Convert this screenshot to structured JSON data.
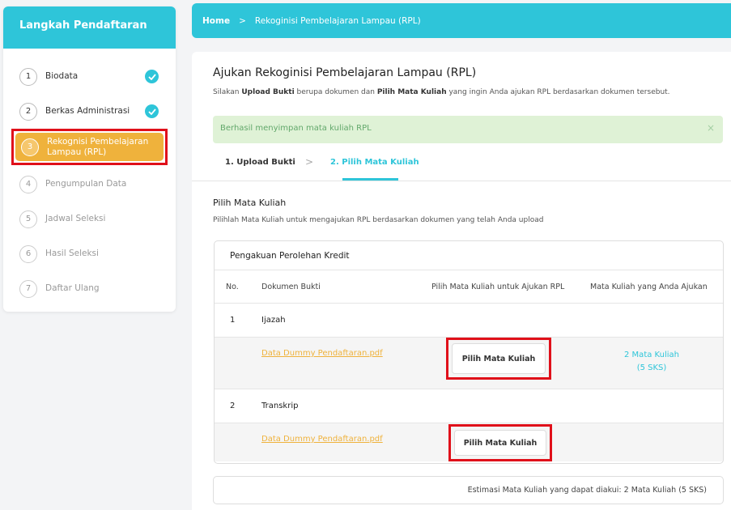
{
  "sidebar": {
    "title": "Langkah Pendaftaran",
    "steps": [
      {
        "num": "1",
        "label": "Biodata"
      },
      {
        "num": "2",
        "label": "Berkas Administrasi"
      },
      {
        "num": "3",
        "label": "Rekognisi Pembelajaran Lampau (RPL)"
      },
      {
        "num": "4",
        "label": "Pengumpulan Data"
      },
      {
        "num": "5",
        "label": "Jadwal Seleksi"
      },
      {
        "num": "6",
        "label": "Hasil Seleksi"
      },
      {
        "num": "7",
        "label": "Daftar Ulang"
      }
    ]
  },
  "breadcrumb": {
    "home": "Home",
    "separator": ">",
    "current": "Rekoginisi Pembelajaran Lampau (RPL)"
  },
  "page": {
    "title": "Ajukan Rekoginisi Pembelajaran Lampau (RPL)",
    "desc_prefix": "Silakan ",
    "desc_b1": "Upload Bukti",
    "desc_mid": " berupa dokumen dan ",
    "desc_b2": "Pilih Mata Kuliah",
    "desc_suffix": " yang ingin Anda ajukan RPL berdasarkan dokumen tersebut."
  },
  "alert": {
    "message": "Berhasil menyimpan mata kuliah RPL",
    "close": "×"
  },
  "tabs": {
    "tab1": "1. Upload Bukti",
    "separator": ">",
    "tab2": "2. Pilih Mata Kuliah"
  },
  "section": {
    "title": "Pilih Mata Kuliah",
    "desc": "Pilihlah Mata Kuliah untuk mengajukan RPL berdasarkan dokumen yang telah Anda upload"
  },
  "table": {
    "card_title": "Pengakuan Perolehan Kredit",
    "headers": {
      "no": "No.",
      "doc": "Dokumen Bukti",
      "pick": "Pilih Mata Kuliah untuk Ajukan RPL",
      "taken": "Mata Kuliah yang Anda Ajukan"
    },
    "rows": [
      {
        "no": "1",
        "name": "Ijazah",
        "file": "Data Dummy Pendaftaran.pdf",
        "button": "Pilih Mata Kuliah",
        "taken_line1": "2 Mata Kuliah",
        "taken_line2": "(5 SKS)"
      },
      {
        "no": "2",
        "name": "Transkrip",
        "file": "Data Dummy Pendaftaran.pdf",
        "button": "Pilih Mata Kuliah"
      }
    ]
  },
  "estimate": "Estimasi Mata Kuliah yang dapat diakui: 2 Mata Kuliah (5 SKS)",
  "colors": {
    "primary": "#2ec5d9",
    "active_step": "#efb23c",
    "highlight_frame": "#e0101a",
    "alert_bg": "#dff2d6",
    "alert_text": "#62a86b"
  }
}
